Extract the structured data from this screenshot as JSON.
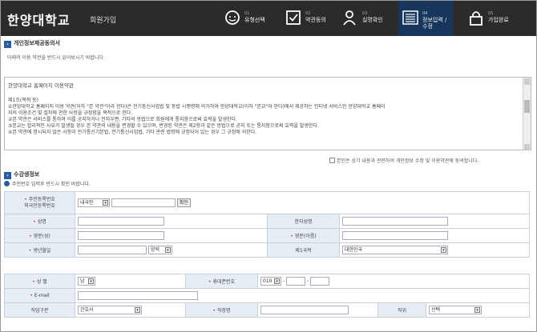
{
  "header": {
    "logo": "한양대학교",
    "subtitle": "회원가입",
    "steps": [
      {
        "num": "01",
        "label": "유형선택",
        "icon": "face-icon"
      },
      {
        "num": "02",
        "label": "약관동의",
        "icon": "check-box-icon"
      },
      {
        "num": "03",
        "label": "실명확인",
        "icon": "person-icon"
      },
      {
        "num": "04",
        "label": "정보입력 / 수정",
        "icon": "list-icon"
      },
      {
        "num": "05",
        "label": "가입완료",
        "icon": "lock-icon"
      }
    ]
  },
  "privacy": {
    "title": "개인정보제공동의서",
    "note": "아래의 이용 약관을 반드시 읽어보시기 바랍니다.",
    "terms_title": "한양대학교 홈페이지 이용약관",
    "terms_lines": [
      "제1조(목적 등)",
      "①한양대학교 홈페이지 이용 약관(이하 \"본 약관\"이라 한다)은 전기통신사업법 및 동법 시행령에 의거하여 한양대학교(이하 \"본교\"라 한다)에서 제공하는 인터넷 서비스인 한양대학교 홈페이",
      "지의 이용조건 및 절차에 관한 사항을 규정함을 목적으로 한다.",
      "②본 약관은 서비스를 통하여 이를 공지하거나 전자우편, 기타의 방법으로 회원에게 통지함으로써 효력을 발생한다.",
      "③본교는 합리적인 사유가 발생될 경우 본 약관의 내용을 변경할 수 있으며, 변경된 약관은 제2항과 같은 방법으로 공지 또는 통지함으로써 효력을 발생한다.",
      "④본 약관에 명시되지 않은 사항이 전기통신기본법, 전기통신사업법, 기타 관련 법령에 규정되어 있는 경우 그 규정에 의한다."
    ],
    "agree_label": "본인은 상기 내용과 관련하여 개인정보 수정 및 이용약관에 동의합니다."
  },
  "member": {
    "title": "수강생정보",
    "note": "주민번호 입력후 반드시 확인 바랍니다.",
    "rrn_label_1": "주민등록번호",
    "rrn_label_2": "외국인등록번호",
    "nationality_select": "내국인",
    "confirm_button": "확인",
    "name_label": "성명",
    "hanja_label": "한자성명",
    "eng_last_label": "영문(성)",
    "eng_first_label": "영문(이름)",
    "birth_label": "생년월일",
    "calendar_select": "양력",
    "nationality_label": "제1국적",
    "country_select": "대한민국",
    "gender_label": "성 별",
    "gender_select": "남",
    "mobile_label": "휴대폰번호",
    "mobile_prefix": "010",
    "dash": "-",
    "email_label": "E-mail",
    "job_label": "직업구분",
    "job_select": "간호사",
    "workplace_label": "직장명",
    "position_label": "직위",
    "position_select": "선택"
  },
  "colors": {
    "header_bg": "#2b2b2b",
    "active_step": "#16365c",
    "label_bg": "#e7edf5",
    "accent": "#2a5aa0"
  }
}
